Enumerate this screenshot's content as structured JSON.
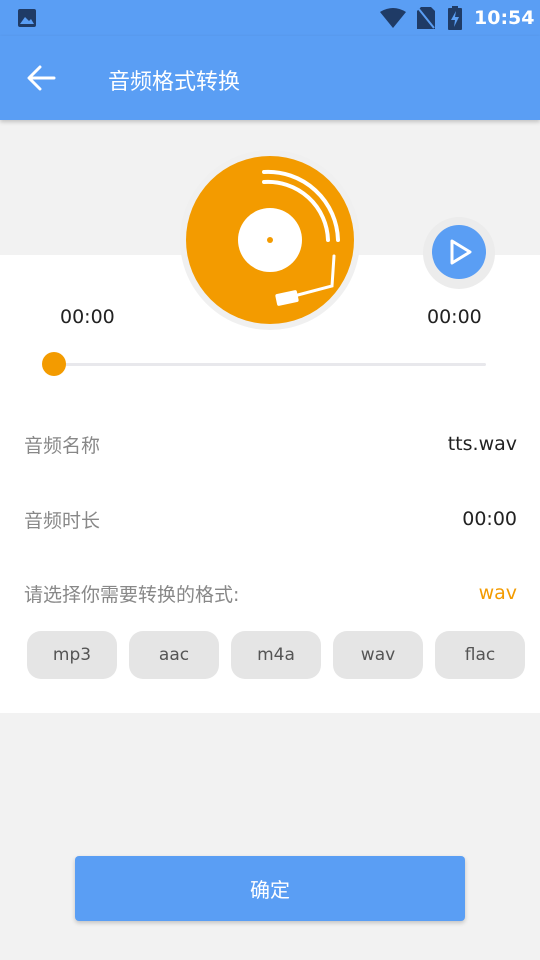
{
  "status_bar": {
    "time": "10:54",
    "icons": [
      "image-icon",
      "wifi-icon",
      "no-sim-icon",
      "battery-charging-icon"
    ]
  },
  "toolbar": {
    "back_icon": "arrow-left-icon",
    "title": "音频格式转换"
  },
  "player": {
    "disc_icon": "vinyl-record-icon",
    "play_icon": "play-icon",
    "current_time": "00:00",
    "total_time": "00:00",
    "progress": 0
  },
  "info": {
    "name_label": "音频名称",
    "name_value": "tts.wav",
    "duration_label": "音频时长",
    "duration_value": "00:00",
    "format_prompt": "请选择你需要转换的格式:",
    "selected_format": "wav"
  },
  "formats": [
    "mp3",
    "aac",
    "m4a",
    "wav",
    "flac"
  ],
  "confirm_label": "确定",
  "colors": {
    "primary": "#5a9ef4",
    "accent": "#f39b00",
    "background": "#f2f2f2",
    "card": "#ffffff",
    "chip": "#e5e5e5"
  }
}
